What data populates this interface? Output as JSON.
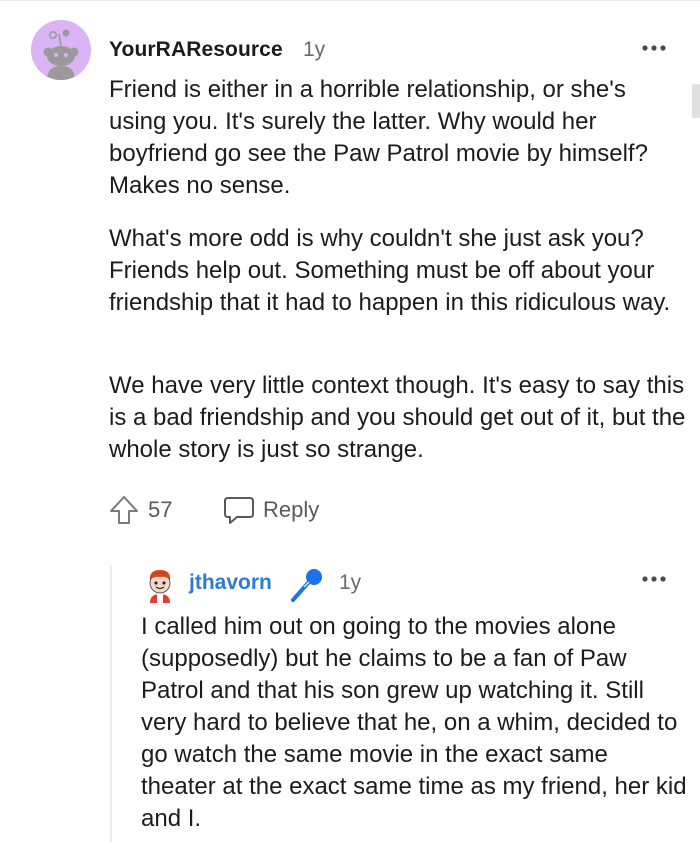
{
  "parent_comment": {
    "username": "YourRAResource",
    "age": "1y",
    "avatar": "snoo-avatar-icon",
    "paragraphs": [
      "Friend is either in a horrible relationship, or she's using you. It's surely the latter. Why would her boyfriend go see the Paw Patrol movie by himself? Makes no sense.",
      "What's more odd is why couldn't she just ask you? Friends help out. Something must be off about your friendship that it had to happen in this ridiculous way.",
      "We have very little context though. It's easy to say this is a bad friendship and you should get out of it, but the whole story is just so strange."
    ],
    "vote_count": "57",
    "reply_label": "Reply",
    "more_icon": "more-options-icon"
  },
  "reply_comment": {
    "username": "jthavorn",
    "age": "1y",
    "avatar": "custom-avatar-icon",
    "flair": "microphone-icon",
    "text": "I called him out on going to the movies alone (supposedly) but he claims to be a fan of Paw Patrol and that his son grew up watching it. Still very hard to believe that he, on a whim, decided to go watch the same movie in the exact same theater at the exact same time as my friend, her kid and I.",
    "more_icon": "more-options-icon"
  },
  "colors": {
    "text": "#1c1c1c",
    "muted": "#6b6b6b",
    "username_link": "#2d7bd4",
    "avatar_bg": "#dbb4f5",
    "thread_line": "#ececec"
  }
}
